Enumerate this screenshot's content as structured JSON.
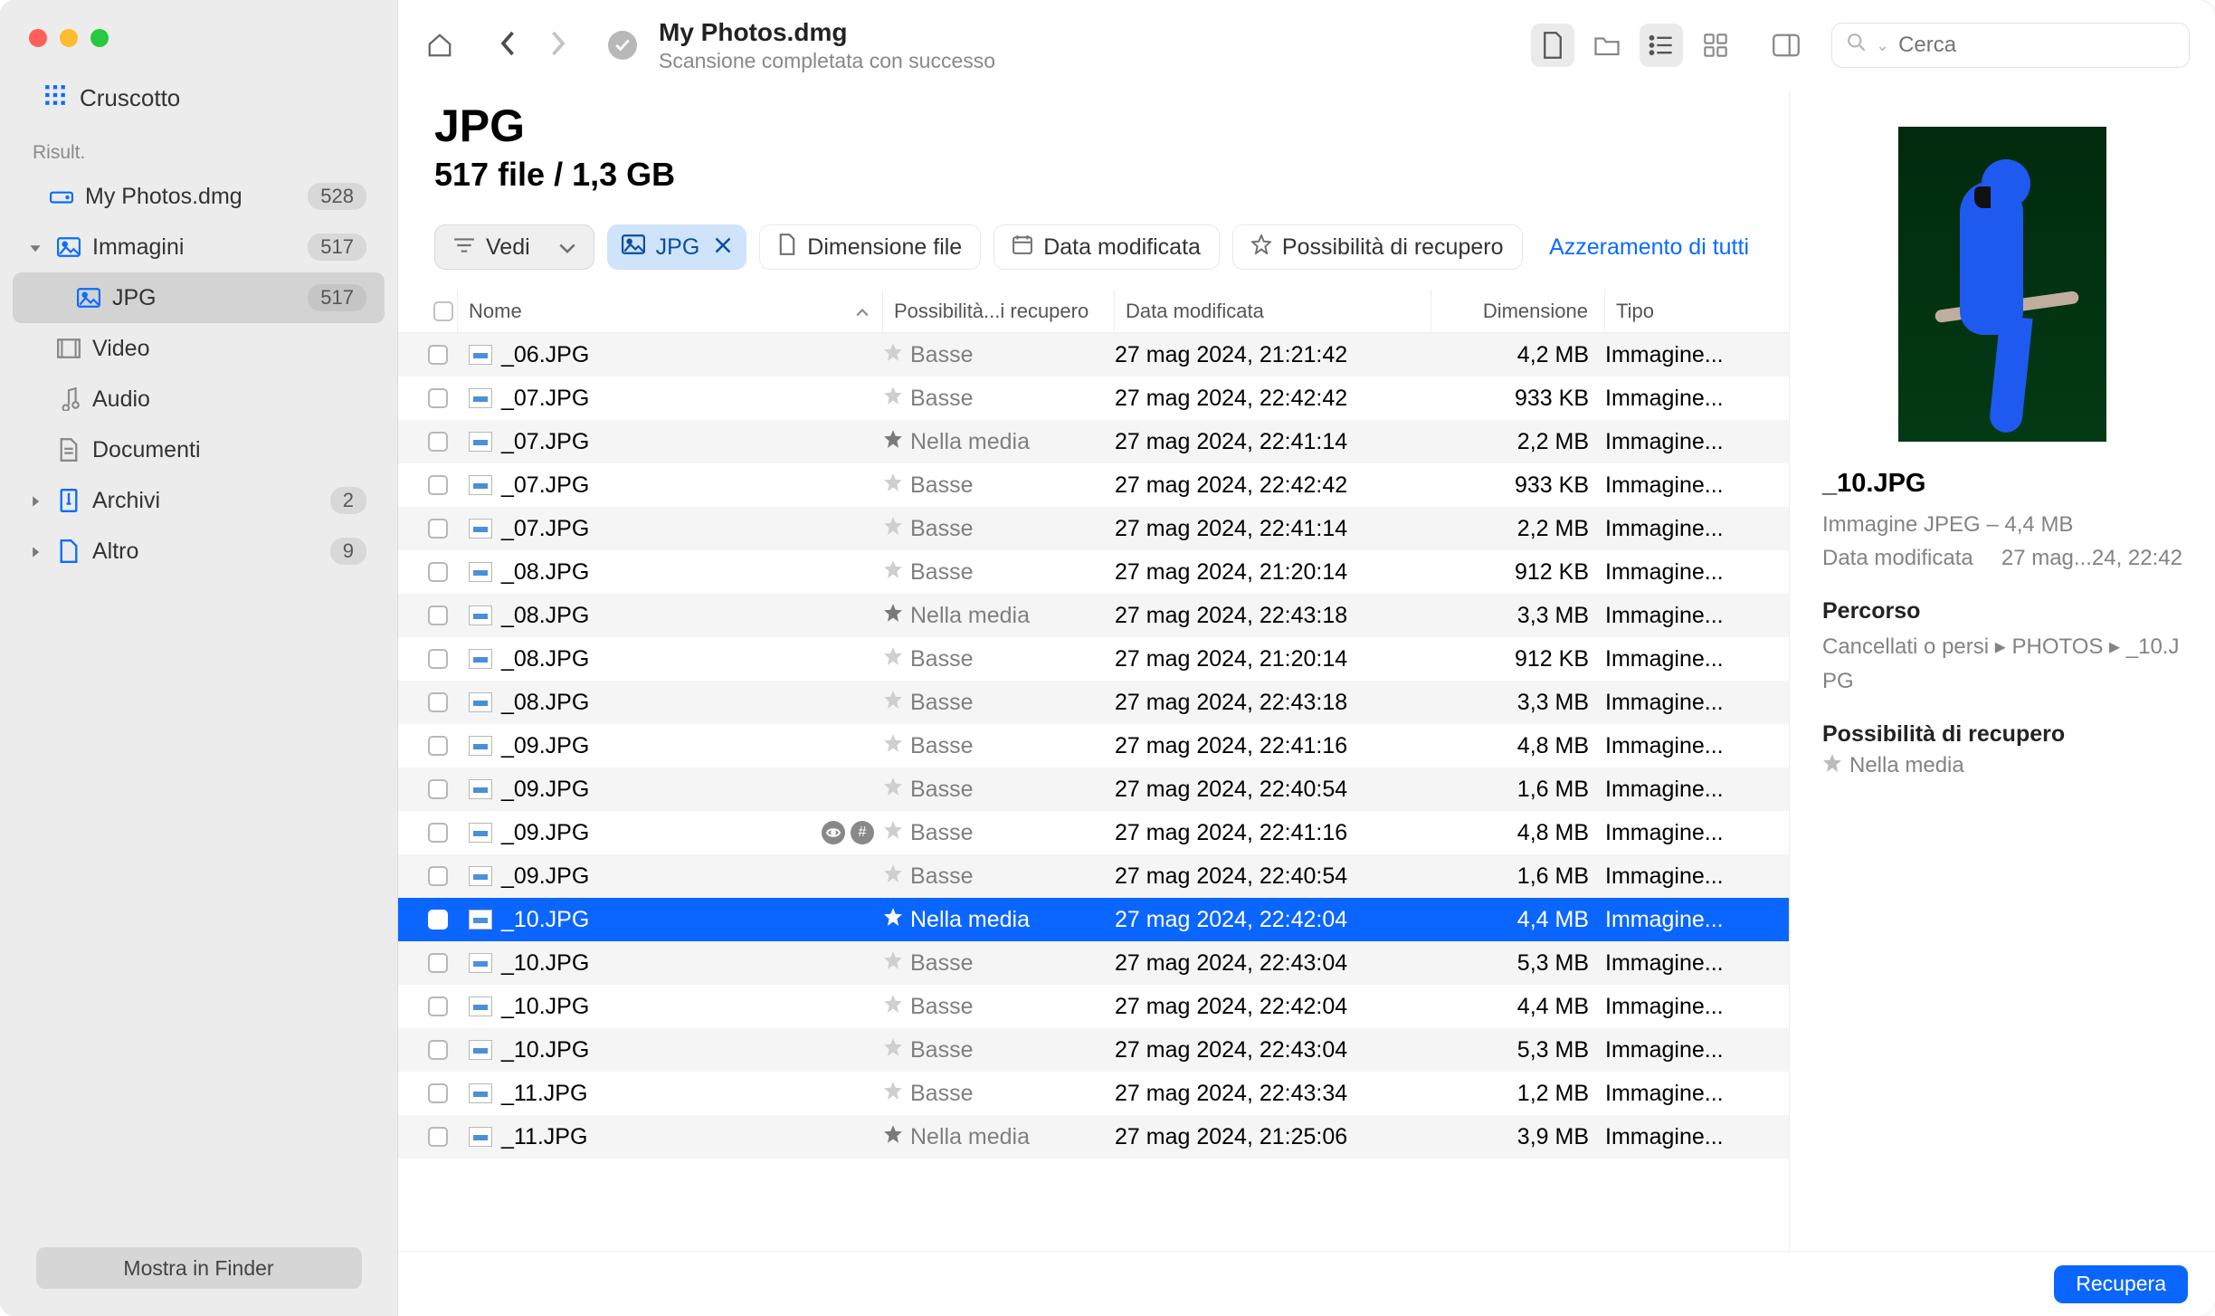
{
  "window": {
    "title": "My Photos.dmg",
    "subtitle": "Scansione completata con successo"
  },
  "search": {
    "placeholder": "Cerca"
  },
  "sidebar": {
    "dashboard": "Cruscotto",
    "section_label": "Risult.",
    "show_in_finder": "Mostra in Finder",
    "items": [
      {
        "label": "My Photos.dmg",
        "badge": "528"
      },
      {
        "label": "Immagini",
        "badge": "517"
      },
      {
        "label": "JPG",
        "badge": "517"
      },
      {
        "label": "Video"
      },
      {
        "label": "Audio"
      },
      {
        "label": "Documenti"
      },
      {
        "label": "Archivi",
        "badge": "2"
      },
      {
        "label": "Altro",
        "badge": "9"
      }
    ]
  },
  "heading": {
    "title": "JPG",
    "subtitle": "517 file / 1,3 GB"
  },
  "filters": {
    "view": "Vedi",
    "active_chip": "JPG",
    "size": "Dimensione file",
    "date": "Data modificata",
    "recovery": "Possibilità di recupero",
    "reset": "Azzeramento di tutti"
  },
  "columns": {
    "name": "Nome",
    "possibility": "Possibilità...i recupero",
    "date": "Data modificata",
    "size": "Dimensione",
    "type": "Tipo"
  },
  "poss_labels": {
    "low": "Basse",
    "mid": "Nella media"
  },
  "type_label": "Immagine...",
  "rows": [
    {
      "n": "_06.JPG",
      "p": "low",
      "d": "27 mag 2024, 21:21:42",
      "s": "4,2 MB"
    },
    {
      "n": "_07.JPG",
      "p": "low",
      "d": "27 mag 2024, 22:42:42",
      "s": "933 KB"
    },
    {
      "n": "_07.JPG",
      "p": "mid",
      "d": "27 mag 2024, 22:41:14",
      "s": "2,2 MB"
    },
    {
      "n": "_07.JPG",
      "p": "low",
      "d": "27 mag 2024, 22:42:42",
      "s": "933 KB"
    },
    {
      "n": "_07.JPG",
      "p": "low",
      "d": "27 mag 2024, 22:41:14",
      "s": "2,2 MB"
    },
    {
      "n": "_08.JPG",
      "p": "low",
      "d": "27 mag 2024, 21:20:14",
      "s": "912 KB"
    },
    {
      "n": "_08.JPG",
      "p": "mid",
      "d": "27 mag 2024, 22:43:18",
      "s": "3,3 MB"
    },
    {
      "n": "_08.JPG",
      "p": "low",
      "d": "27 mag 2024, 21:20:14",
      "s": "912 KB"
    },
    {
      "n": "_08.JPG",
      "p": "low",
      "d": "27 mag 2024, 22:43:18",
      "s": "3,3 MB"
    },
    {
      "n": "_09.JPG",
      "p": "low",
      "d": "27 mag 2024, 22:41:16",
      "s": "4,8 MB"
    },
    {
      "n": "_09.JPG",
      "p": "low",
      "d": "27 mag 2024, 22:40:54",
      "s": "1,6 MB"
    },
    {
      "n": "_09.JPG",
      "p": "low",
      "d": "27 mag 2024, 22:41:16",
      "s": "4,8 MB",
      "extra": true
    },
    {
      "n": "_09.JPG",
      "p": "low",
      "d": "27 mag 2024, 22:40:54",
      "s": "1,6 MB"
    },
    {
      "n": "_10.JPG",
      "p": "mid",
      "d": "27 mag 2024, 22:42:04",
      "s": "4,4 MB",
      "sel": true
    },
    {
      "n": "_10.JPG",
      "p": "low",
      "d": "27 mag 2024, 22:43:04",
      "s": "5,3 MB"
    },
    {
      "n": "_10.JPG",
      "p": "low",
      "d": "27 mag 2024, 22:42:04",
      "s": "4,4 MB"
    },
    {
      "n": "_10.JPG",
      "p": "low",
      "d": "27 mag 2024, 22:43:04",
      "s": "5,3 MB"
    },
    {
      "n": "_11.JPG",
      "p": "low",
      "d": "27 mag 2024, 22:43:34",
      "s": "1,2 MB"
    },
    {
      "n": "_11.JPG",
      "p": "mid",
      "d": "27 mag 2024, 21:25:06",
      "s": "3,9 MB"
    }
  ],
  "detail": {
    "filename": "_10.JPG",
    "typesize": "Immagine JPEG – 4,4 MB",
    "date_label": "Data modificata",
    "date_value": "27 mag...24, 22:42",
    "path_label": "Percorso",
    "path_value": "Cancellati o persi ▸ PHOTOS ▸ _10.JPG",
    "recovery_label": "Possibilità di recupero",
    "recovery_value": "Nella media"
  },
  "footer": {
    "recover": "Recupera"
  }
}
